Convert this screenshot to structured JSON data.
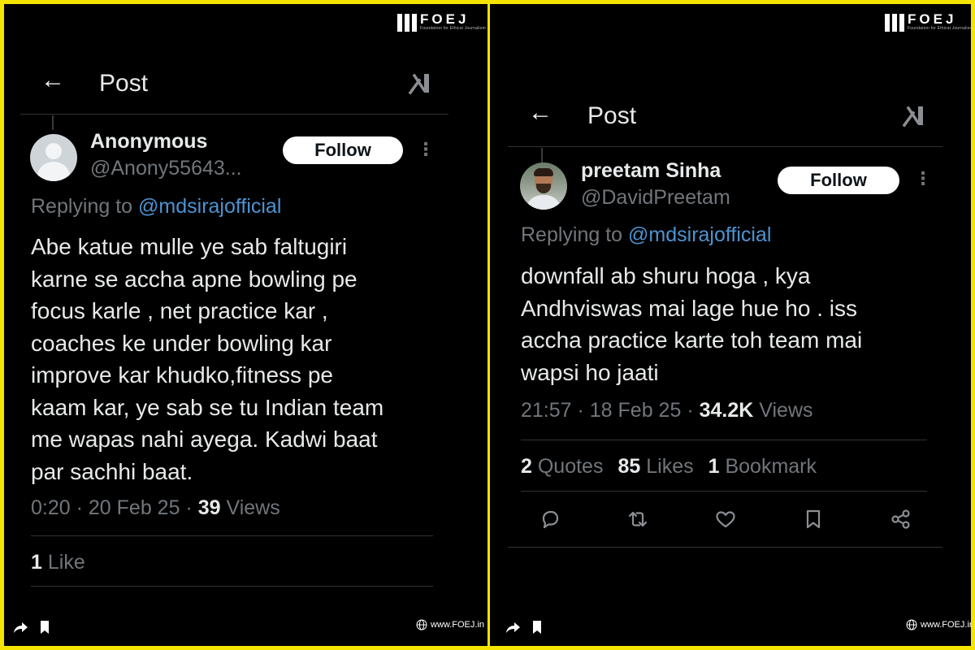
{
  "brand": {
    "name": "FOEJ",
    "tagline": "Foundation for Ethical Journalism",
    "site": "www.FOEJ.in"
  },
  "left": {
    "header_title": "Post",
    "user": {
      "name": "Anonymous",
      "handle": "@Anony55643..."
    },
    "follow_label": "Follow",
    "replying_prefix": "Replying to",
    "replying_handle": "@mdsirajofficial",
    "body_lines": [
      "Abe katue mulle ye sab faltugiri",
      "karne se accha apne bowling pe",
      "focus karle , net practice kar ,",
      "coaches ke under bowling kar",
      "improve kar khudko,fitness pe",
      "kaam kar, ye sab se tu Indian team",
      "me wapas nahi ayega. Kadwi baat",
      "par sachhi baat."
    ],
    "meta": {
      "time": "0:20",
      "date": "20 Feb 25",
      "views_count": "39",
      "views_label": "Views"
    },
    "stats": {
      "likes_count": "1",
      "likes_label": "Like"
    }
  },
  "right": {
    "header_title": "Post",
    "user": {
      "name": "preetam Sinha",
      "handle": "@DavidPreetam"
    },
    "follow_label": "Follow",
    "replying_prefix": "Replying to",
    "replying_handle": "@mdsirajofficial",
    "body_lines": [
      "downfall ab shuru hoga , kya",
      "Andhviswas mai lage hue ho . iss",
      "accha practice karte toh team mai",
      "wapsi ho jaati"
    ],
    "meta": {
      "time": "21:57",
      "date": "18 Feb 25",
      "views_count": "34.2K",
      "views_label": "Views"
    },
    "stats": {
      "quotes_count": "2",
      "quotes_label": "Quotes",
      "likes_count": "85",
      "likes_label": "Likes",
      "bookmarks_count": "1",
      "bookmarks_label": "Bookmark"
    },
    "actions": [
      "reply-icon",
      "repost-icon",
      "like-icon",
      "bookmark-icon",
      "share-icon"
    ]
  },
  "colors": {
    "frame": "#f5e400",
    "background": "#000000",
    "mention": "#4d93d1",
    "muted": "#71767b"
  }
}
